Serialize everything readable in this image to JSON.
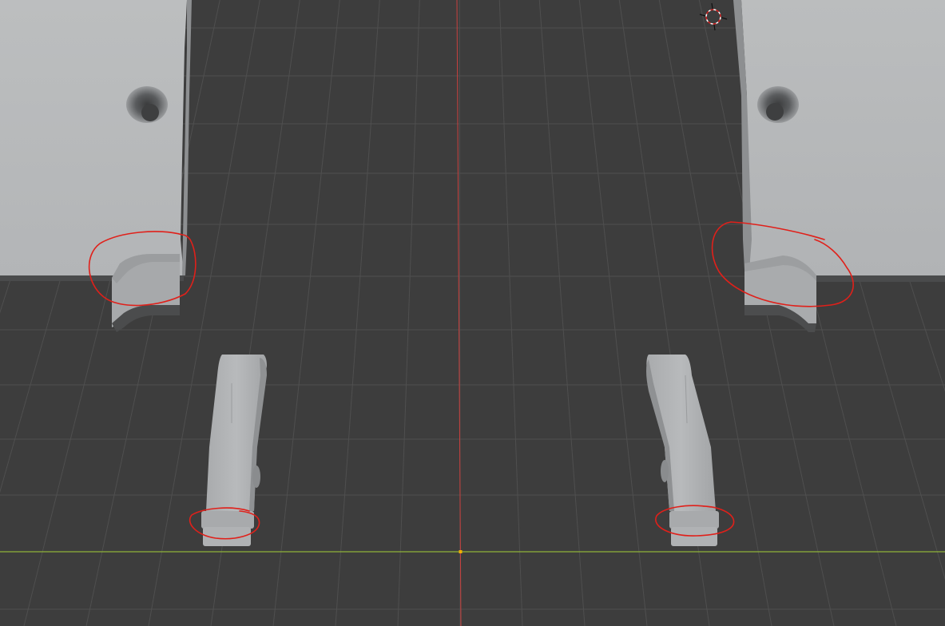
{
  "viewport": {
    "editor": "3D Viewport",
    "view": "perspective",
    "colors": {
      "background": "#3d3d3d",
      "grid_line": "#4f4f4f",
      "x_axis": "#8fb33a",
      "y_axis": "#c9403e",
      "mesh_light": "#b4b6b8",
      "mesh_shadow": "#5a5b5c",
      "annotation": "#e0201a",
      "origin_point": "#f0b000"
    }
  },
  "scene": {
    "objects": [
      {
        "label": "bracket-left",
        "type": "mesh"
      },
      {
        "label": "bracket-right",
        "type": "mesh"
      },
      {
        "label": "lever-left",
        "type": "mesh"
      },
      {
        "label": "lever-right",
        "type": "mesh"
      }
    ],
    "cursor": "3d-cursor",
    "annotations": [
      {
        "label": "highlight-left-bracket-tab"
      },
      {
        "label": "highlight-right-bracket-tab"
      },
      {
        "label": "highlight-left-lever-foot"
      },
      {
        "label": "highlight-right-lever-foot"
      }
    ]
  }
}
